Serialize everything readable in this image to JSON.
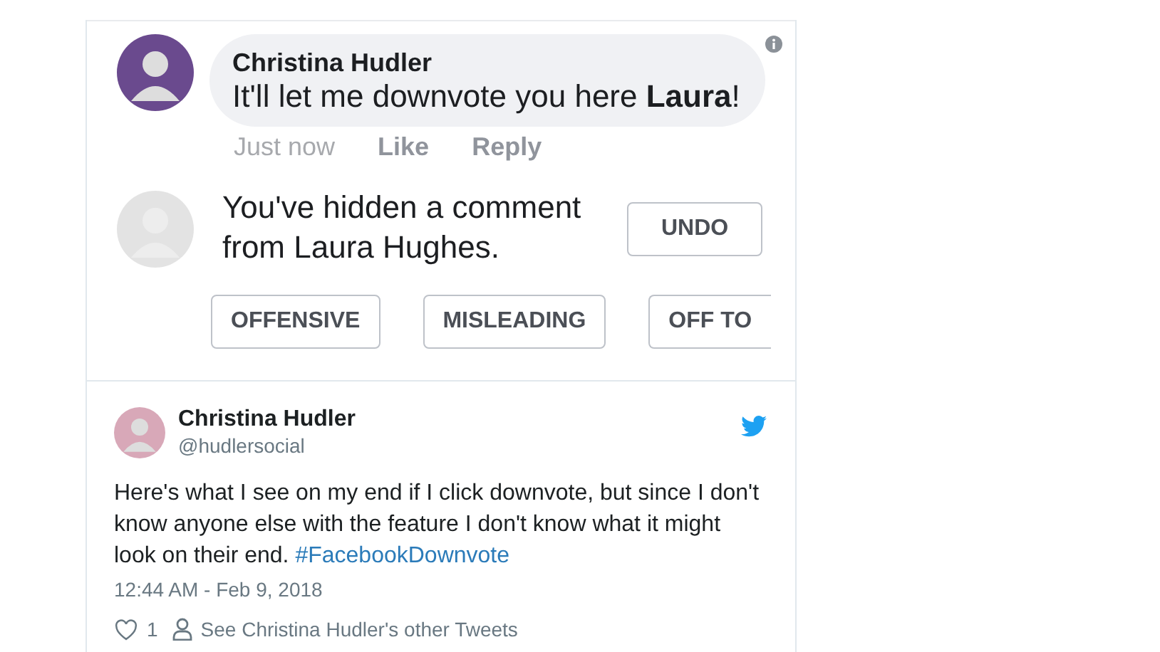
{
  "screenshot": {
    "comment": {
      "author": "Christina Hudler",
      "text": "It'll let me downvote you here **Laura**!",
      "time": "Just now",
      "actions": [
        "Like",
        "Reply"
      ]
    },
    "hidden_notice": {
      "text": "You've hidden a comment from Laura Hughes.",
      "undo": "UNDO",
      "reasons": [
        "OFFENSIVE",
        "MISLEADING",
        "OFF TO"
      ]
    }
  },
  "tweet": {
    "author": "Christina Hudler",
    "handle": "@hudlersocial",
    "text": "Here's what I see on my end if I click downvote, but since I don't know anyone else with the feature I don't know what it might look on their end.",
    "hashtag": "#FacebookDownvote",
    "timestamp": "12:44 AM - Feb 9, 2018",
    "likes": "1",
    "other_tweets": "See Christina Hudler's other Tweets"
  }
}
